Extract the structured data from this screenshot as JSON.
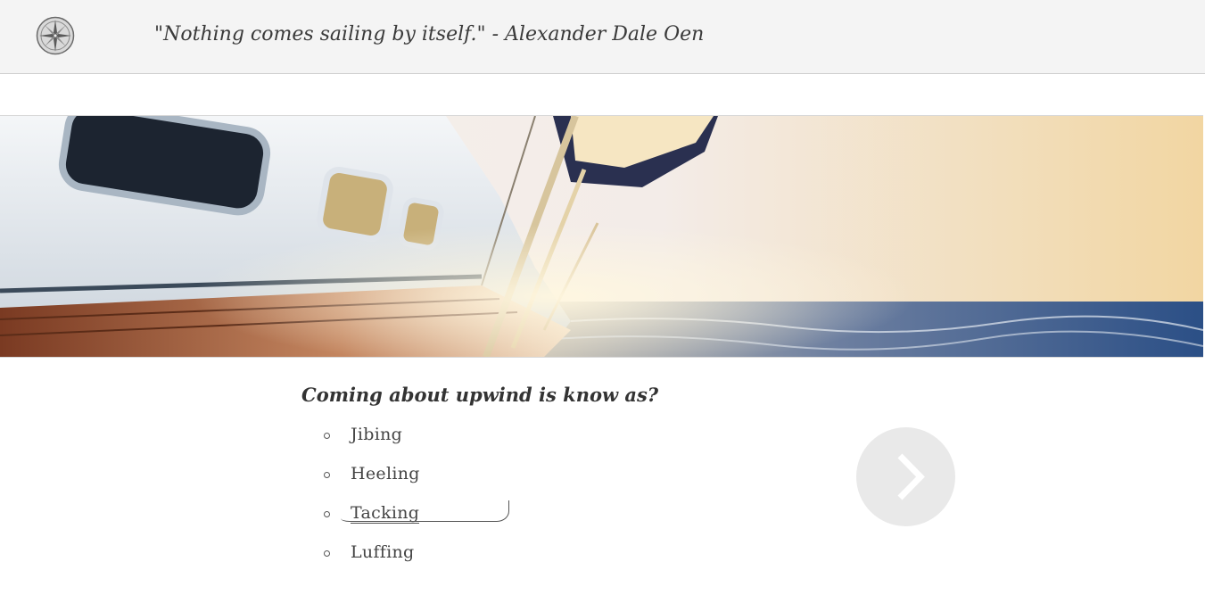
{
  "header": {
    "logo_icon": "compass-icon",
    "quote": "\"Nothing comes sailing by itself.\" - Alexander Dale Oen"
  },
  "hero": {
    "image": "sailboat-at-sunset-banner"
  },
  "quiz": {
    "question": "Coming about upwind is know as?",
    "answers": [
      {
        "label": "Jibing",
        "selected": false
      },
      {
        "label": "Heeling",
        "selected": false
      },
      {
        "label": "Tacking",
        "selected": true
      },
      {
        "label": "Luffing",
        "selected": false
      }
    ],
    "next_icon": "chevron-right-icon"
  },
  "colors": {
    "header_bg": "#f4f4f4",
    "next_button_bg": "#e9e9e9",
    "text": "#333333"
  }
}
